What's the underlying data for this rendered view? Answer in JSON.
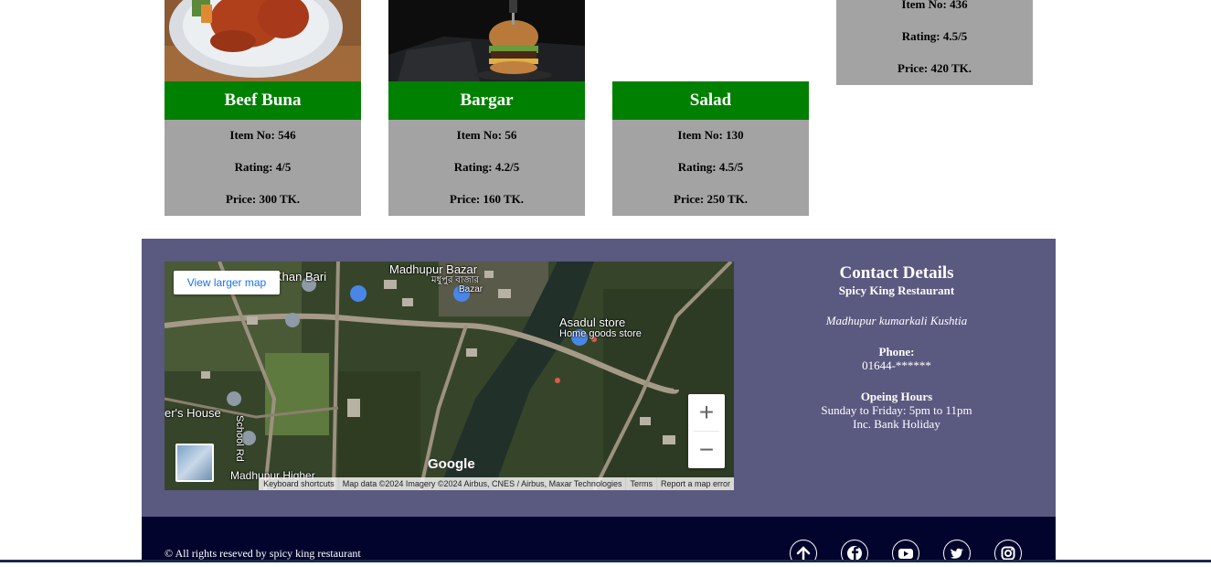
{
  "menu": {
    "top_item": {
      "item_no": "Item No: 436",
      "rating": "Rating: 4.5/5",
      "price": "Price: 420 TK."
    },
    "items": [
      {
        "name": "Beef Buna",
        "item_no": "Item No: 546",
        "rating": "Rating: 4/5",
        "price": "Price: 300 TK.",
        "image": "chicken-wings-photo"
      },
      {
        "name": "Bargar",
        "item_no": "Item No: 56",
        "rating": "Rating: 4.2/5",
        "price": "Price: 160 TK.",
        "image": "burger-photo"
      },
      {
        "name": "Salad",
        "item_no": "Item No: 130",
        "rating": "Rating: 4.5/5",
        "price": "Price: 250 TK.",
        "image": ""
      }
    ]
  },
  "map": {
    "view_larger": "View larger map",
    "labels": {
      "khan_bari": "Khan Bari",
      "madhupur_bazar": "Madhupur Bazar",
      "bazar_bn": "মধুপুর বাজার",
      "bazar": "Bazar",
      "asadul_store": "Asadul store",
      "home_goods": "Home goods store",
      "house": "er's House",
      "school_rd": "School Rd",
      "madhupur_higher": "Madhupur Higher"
    },
    "google": "Google",
    "attribution": {
      "shortcuts": "Keyboard shortcuts",
      "data": "Map data ©2024 Imagery ©2024 Airbus, CNES / Airbus, Maxar Technologies",
      "terms": "Terms",
      "report": "Report a map error"
    },
    "zoom_in": "+",
    "zoom_out": "−"
  },
  "contact": {
    "heading": "Contact Details",
    "name": "Spicy King Restaurant",
    "address": "Madhupur kumarkali Kushtia",
    "phone_label": "Phone:",
    "phone": "01644-******",
    "hours_label": "Opeing Hours",
    "hours": "Sunday to Friday: 5pm to 11pm",
    "holiday": "Inc. Bank Holiday"
  },
  "footer": {
    "copyright": "© All rights reseved by spicy king restaurant",
    "social_icons": [
      "arrow-up-icon",
      "facebook-icon",
      "youtube-icon",
      "twitter-icon",
      "instagram-icon"
    ]
  },
  "colors": {
    "card_title_bg": "#008000",
    "card_info_bg": "#a3a3a3",
    "contact_bg": "#5a5980",
    "footer_bg": "#03042e"
  }
}
